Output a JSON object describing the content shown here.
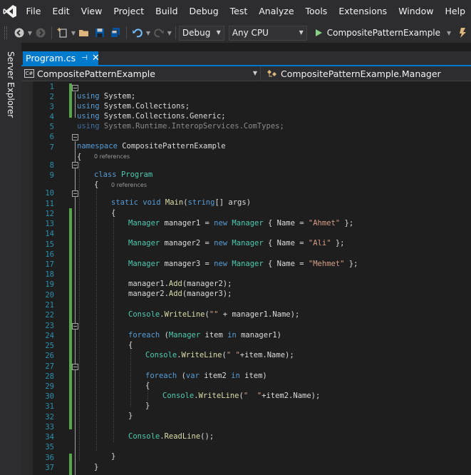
{
  "menu": [
    "File",
    "Edit",
    "View",
    "Project",
    "Build",
    "Debug",
    "Test",
    "Analyze",
    "Tools",
    "Extensions",
    "Window",
    "Help"
  ],
  "toolbar": {
    "configuration": "Debug",
    "platform": "Any CPU",
    "start_target": "CompositePatternExample"
  },
  "side_panel": {
    "server_explorer": "Server Explorer"
  },
  "tab": {
    "label": "Program.cs",
    "pin": "⊣",
    "close": "✕"
  },
  "navbar": {
    "badge": "C#",
    "project": "CompositePatternExample",
    "class": "CompositePatternExample.Manager"
  },
  "codelens": {
    "class_refs": "0 references",
    "main_refs": "0 references"
  },
  "code": {
    "line_numbers": [
      "1",
      "2",
      "3",
      "4",
      "5",
      "6",
      "7",
      "8",
      "9",
      "10",
      "11",
      "12",
      "13",
      "14",
      "15",
      "16",
      "17",
      "18",
      "19",
      "20",
      "21",
      "22",
      "23",
      "24",
      "25",
      "26",
      "27",
      "28",
      "29",
      "30",
      "31",
      "32",
      "33",
      "34",
      "35",
      "36",
      "37"
    ],
    "l1": [
      "using",
      " System;"
    ],
    "l2": [
      "using",
      " System.Collections;"
    ],
    "l3": [
      "using",
      " System.Collections.Generic;"
    ],
    "l4": [
      "using",
      " System.Runtime.InteropServices.ComTypes;"
    ],
    "l6": [
      "namespace",
      " CompositePatternExample"
    ],
    "l7": "{",
    "l8": [
      "class",
      " ",
      "Program"
    ],
    "l9": "{",
    "l10": [
      "static",
      " ",
      "void",
      " ",
      "Main",
      "(",
      "string",
      "[] args)"
    ],
    "l11": "{",
    "l12": [
      "Manager",
      " manager1 = ",
      "new",
      " ",
      "Manager",
      " { Name = ",
      "\"Ahmet\"",
      " };"
    ],
    "l14": [
      "Manager",
      " manager2 = ",
      "new",
      " ",
      "Manager",
      " { Name = ",
      "\"Ali\"",
      " };"
    ],
    "l16": [
      "Manager",
      " manager3 = ",
      "new",
      " ",
      "Manager",
      " { Name = ",
      "\"Mehmet\"",
      " };"
    ],
    "l18": [
      "manager1.",
      "Add",
      "(manager2);"
    ],
    "l19": [
      "manager2.",
      "Add",
      "(manager3);"
    ],
    "l21": [
      "Console",
      ".",
      "WriteLine",
      "(",
      "\"\"",
      " + manager1.Name);"
    ],
    "l23": [
      "foreach",
      " (",
      "Manager",
      " item ",
      "in",
      " manager1)"
    ],
    "l24": "{",
    "l25": [
      "Console",
      ".",
      "WriteLine",
      "(",
      "\" \"",
      "+item.Name);"
    ],
    "l27": [
      "foreach",
      " (",
      "var",
      " item2 ",
      "in",
      " item)"
    ],
    "l28": "{",
    "l29": [
      "Console",
      ".",
      "WriteLine",
      "(",
      "\"  \"",
      "+item2.Name);"
    ],
    "l30": "}",
    "l31": "}",
    "l33": [
      "Console",
      ".",
      "ReadLine",
      "();"
    ],
    "l35": "}",
    "l36": "}"
  },
  "colors": {
    "keyword": "#569cd6",
    "type": "#4ec9b0",
    "string": "#d69d85",
    "method": "#dcdcaa",
    "accent": "#007acc",
    "change_bar": "#57a64a"
  }
}
